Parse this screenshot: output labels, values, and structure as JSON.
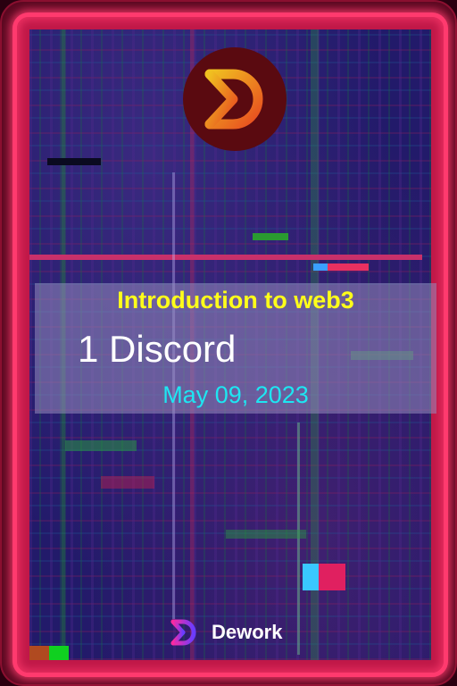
{
  "card": {
    "title": "Introduction to web3",
    "subtitle": "1 Discord",
    "date": "May 09, 2023"
  },
  "brand": {
    "name": "Dework",
    "icon": "dework-logo-icon"
  },
  "logo": {
    "icon": "dework-logo-icon"
  },
  "colors": {
    "frame_glow": "#ff3a6e",
    "title": "#ffff1a",
    "subtitle": "#ffffff",
    "date": "#1ee6f2",
    "logo_gradient_start": "#f0c020",
    "logo_gradient_end": "#e84a20",
    "brand_gradient_start": "#ff2aa0",
    "brand_gradient_end": "#6a3cff"
  }
}
